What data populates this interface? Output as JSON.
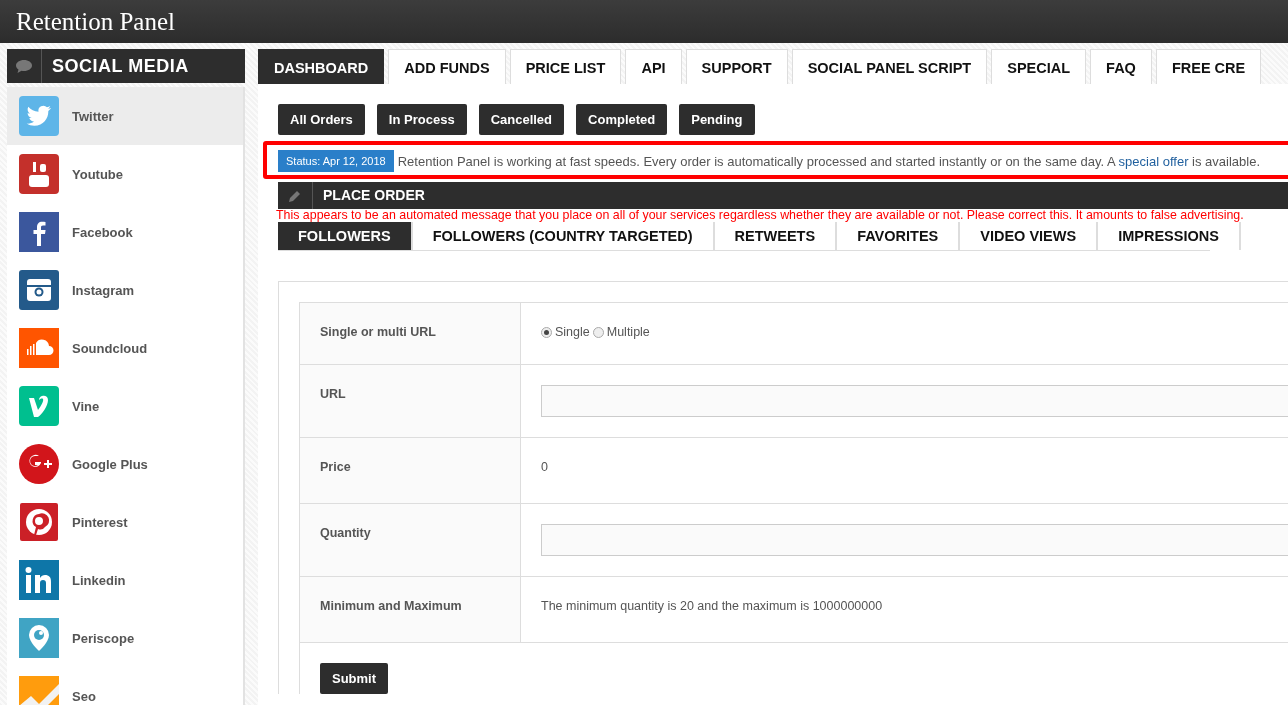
{
  "header": {
    "title": "Retention Panel"
  },
  "sidebar": {
    "title": "SOCIAL MEDIA",
    "items": [
      {
        "label": "Twitter",
        "selected": true
      },
      {
        "label": "Youtube",
        "selected": false
      },
      {
        "label": "Facebook",
        "selected": false
      },
      {
        "label": "Instagram",
        "selected": false
      },
      {
        "label": "Soundcloud",
        "selected": false
      },
      {
        "label": "Vine",
        "selected": false
      },
      {
        "label": "Google Plus",
        "selected": false
      },
      {
        "label": "Pinterest",
        "selected": false
      },
      {
        "label": "Linkedin",
        "selected": false
      },
      {
        "label": "Periscope",
        "selected": false
      },
      {
        "label": "Seo",
        "selected": false
      }
    ]
  },
  "tabs": [
    {
      "label": "DASHBOARD",
      "selected": true
    },
    {
      "label": "ADD FUNDS",
      "selected": false
    },
    {
      "label": "PRICE LIST",
      "selected": false
    },
    {
      "label": "API",
      "selected": false
    },
    {
      "label": "SUPPORT",
      "selected": false
    },
    {
      "label": "SOCIAL PANEL SCRIPT",
      "selected": false
    },
    {
      "label": "SPECIAL",
      "selected": false
    },
    {
      "label": "FAQ",
      "selected": false
    },
    {
      "label": "FREE CRE",
      "selected": false
    }
  ],
  "order_filters": [
    "All Orders",
    "In Process",
    "Cancelled",
    "Completed",
    "Pending"
  ],
  "status": {
    "badge": "Status: Apr 12, 2018",
    "before": "Retention Panel is working at fast speeds. Every order is automatically processed and started instantly or on the same day. A ",
    "link": "special offer",
    "after": " is available."
  },
  "place_order": {
    "title": "PLACE ORDER"
  },
  "annotation": "This appears to be an automated message that you place on all of your services regardless whether they are available or not. Please correct this. It amounts to false advertising.",
  "service_tabs": [
    {
      "label": "FOLLOWERS",
      "selected": true
    },
    {
      "label": "FOLLOWERS (COUNTRY TARGETED)",
      "selected": false
    },
    {
      "label": "RETWEETS",
      "selected": false
    },
    {
      "label": "FAVORITES",
      "selected": false
    },
    {
      "label": "VIDEO VIEWS",
      "selected": false
    },
    {
      "label": "IMPRESSIONS",
      "selected": false
    }
  ],
  "form": {
    "rows": [
      {
        "kind": "radio",
        "label": "Single or multi URL",
        "options": [
          {
            "label": "Single",
            "selected": true
          },
          {
            "label": "Multiple",
            "selected": false
          }
        ]
      },
      {
        "kind": "input",
        "label": "URL"
      },
      {
        "kind": "text",
        "label": "Price",
        "value": "0"
      },
      {
        "kind": "input",
        "label": "Quantity"
      },
      {
        "kind": "text",
        "label": "Minimum and Maximum",
        "value": "The minimum quantity is 20 and the maximum is 1000000000"
      }
    ],
    "submit": "Submit"
  }
}
